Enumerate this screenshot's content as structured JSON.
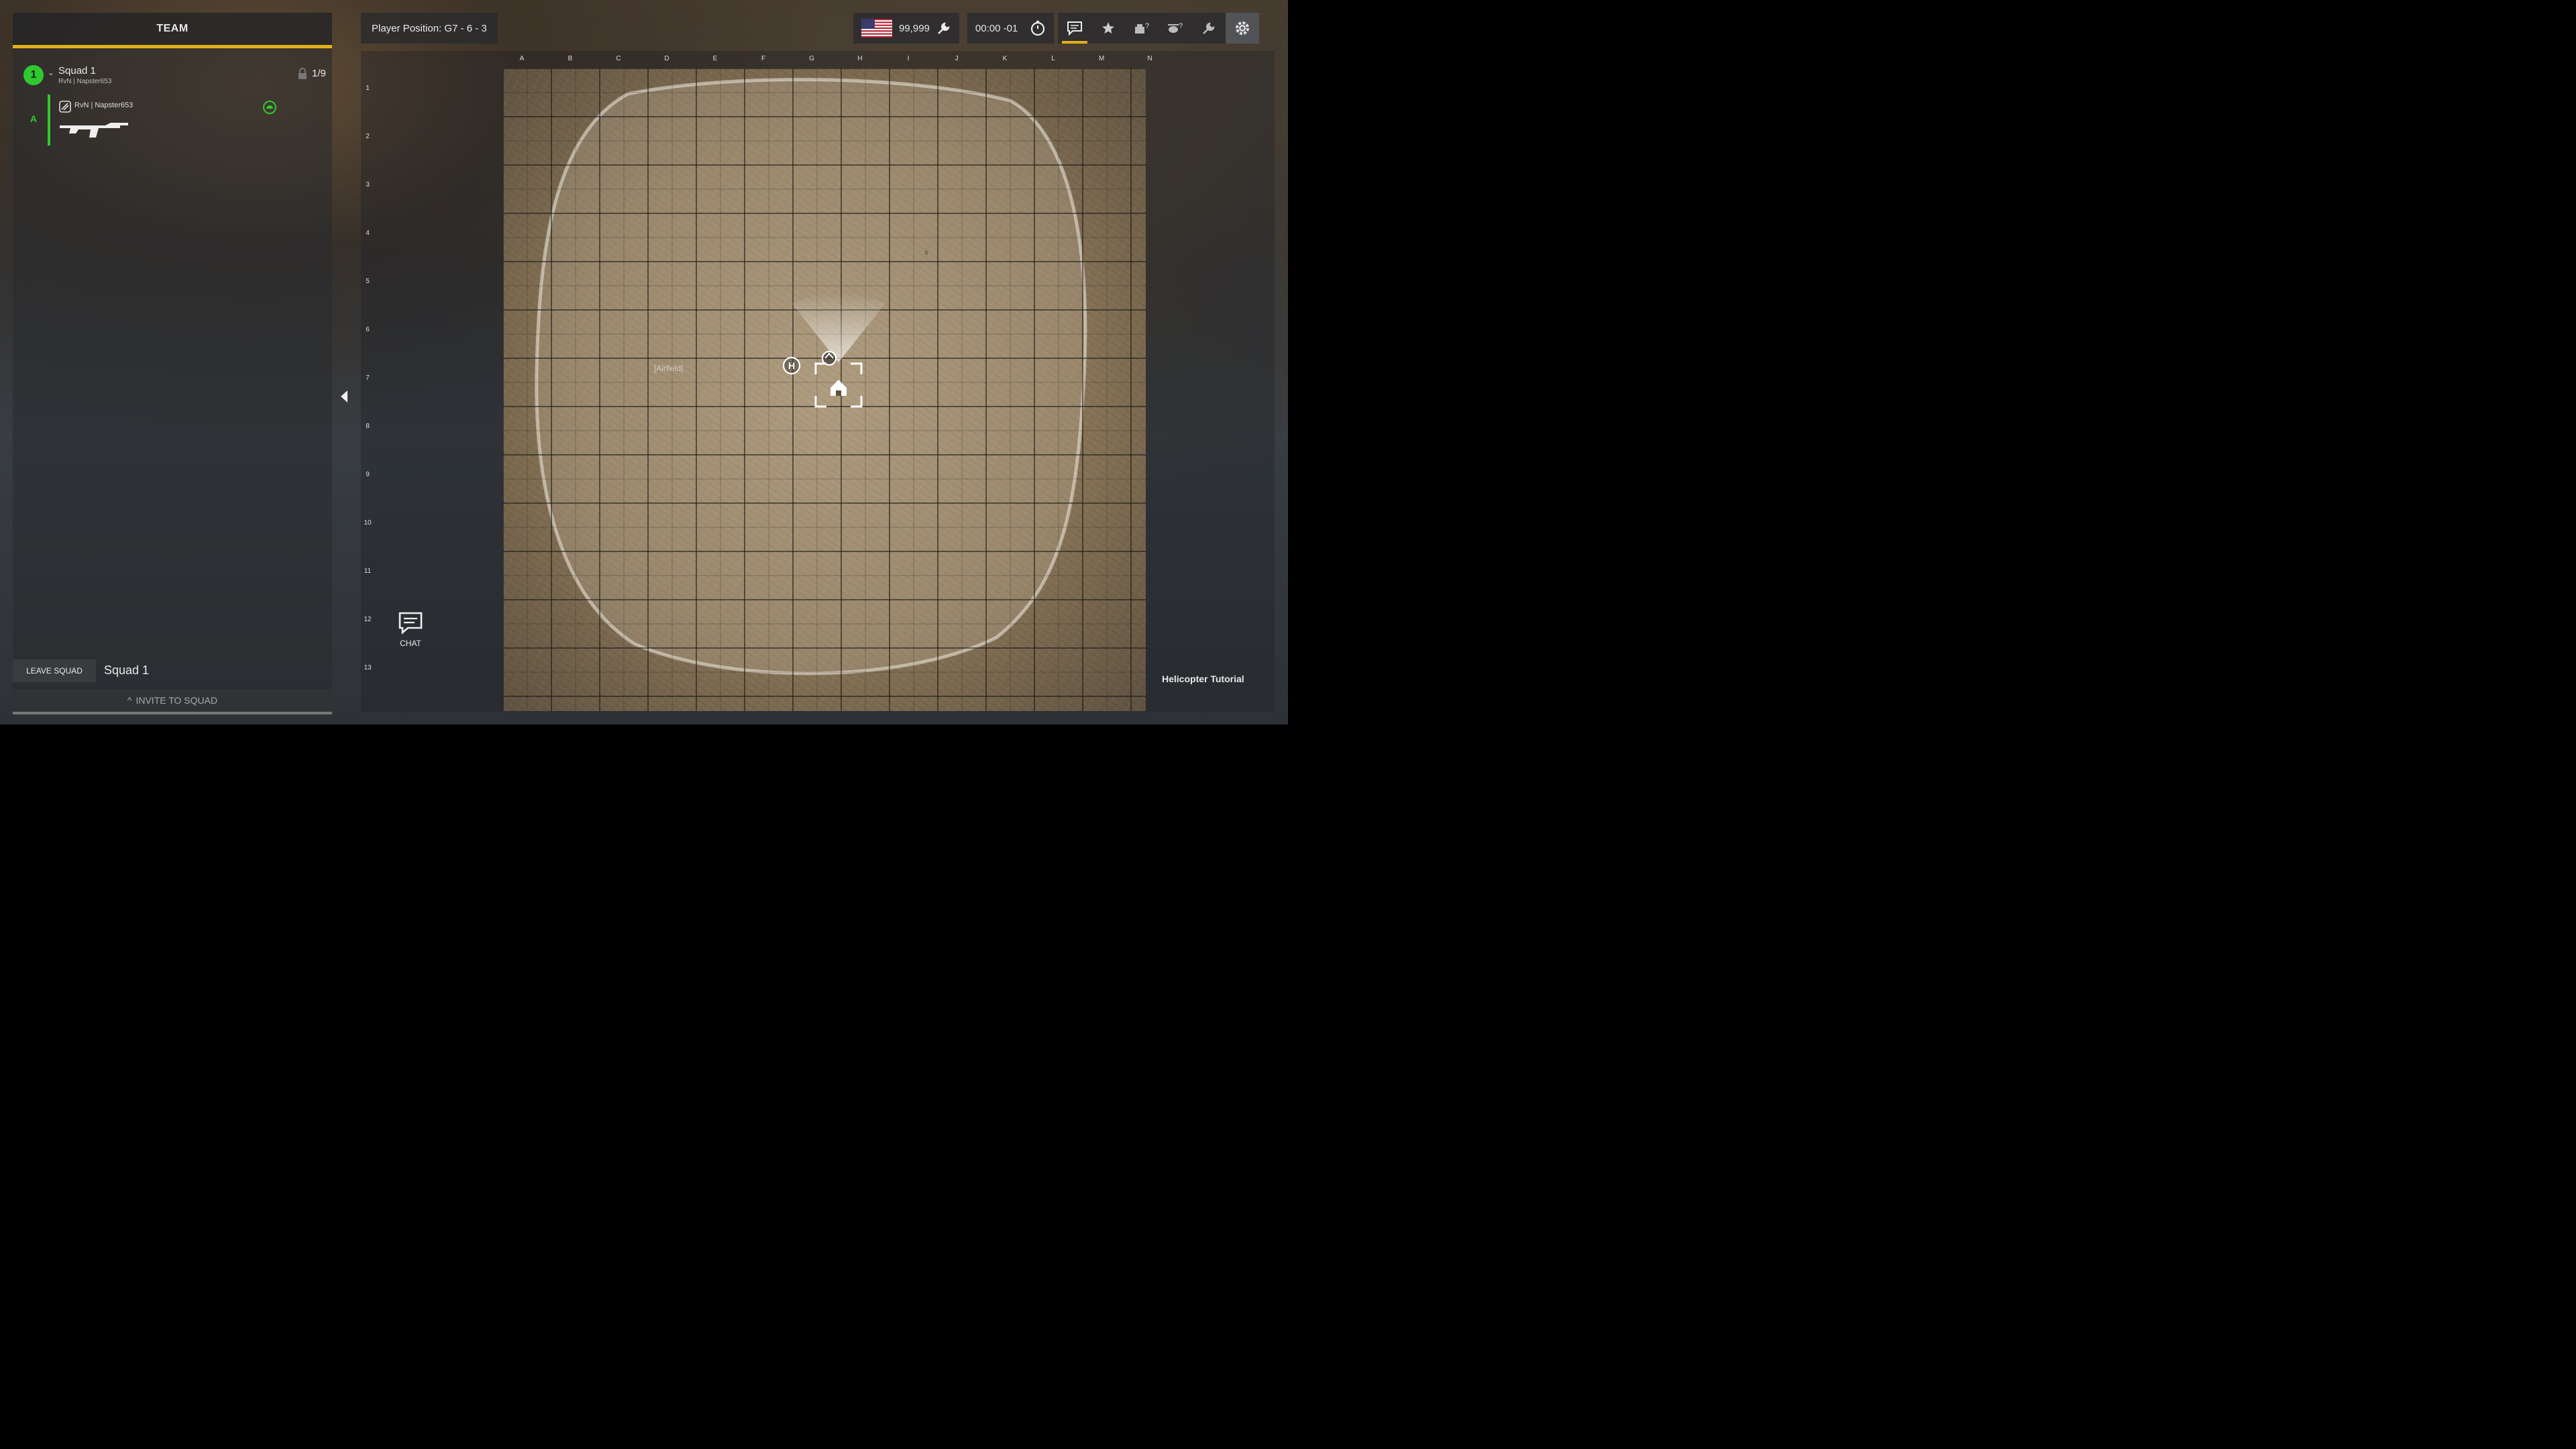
{
  "team_panel": {
    "header": "TEAM",
    "squad": {
      "number": "1",
      "name": "Squad 1",
      "leader_sub": "RvN | Napster653",
      "count": "1/9"
    },
    "member": {
      "fireteam": "A",
      "name": "RvN | Napster653"
    },
    "leave_squad": "LEAVE SQUAD",
    "squad_label": "Squad 1",
    "invite": "INVITE TO SQUAD"
  },
  "top_bar": {
    "player_position": "Player Position: G7 - 6 - 3",
    "credits": "99,999",
    "timer": "00:00 -01",
    "icons": [
      "chat-icon",
      "star-icon",
      "vehicle-help-icon",
      "helicopter-help-icon",
      "wrench-icon",
      "gear-icon"
    ]
  },
  "map": {
    "columns": [
      "A",
      "B",
      "C",
      "D",
      "E",
      "F",
      "G",
      "H",
      "I",
      "J",
      "K",
      "L",
      "M",
      "N"
    ],
    "rows": [
      "1",
      "2",
      "3",
      "4",
      "5",
      "6",
      "7",
      "8",
      "9",
      "10",
      "11",
      "12",
      "13"
    ],
    "region_label": "[Airfield]",
    "point_label": "X"
  },
  "chat": {
    "label": "CHAT"
  },
  "tutorial": {
    "label": "Helicopter Tutorial"
  },
  "colors": {
    "accent": "#e0b11a",
    "squad_green": "#2fc92f"
  }
}
